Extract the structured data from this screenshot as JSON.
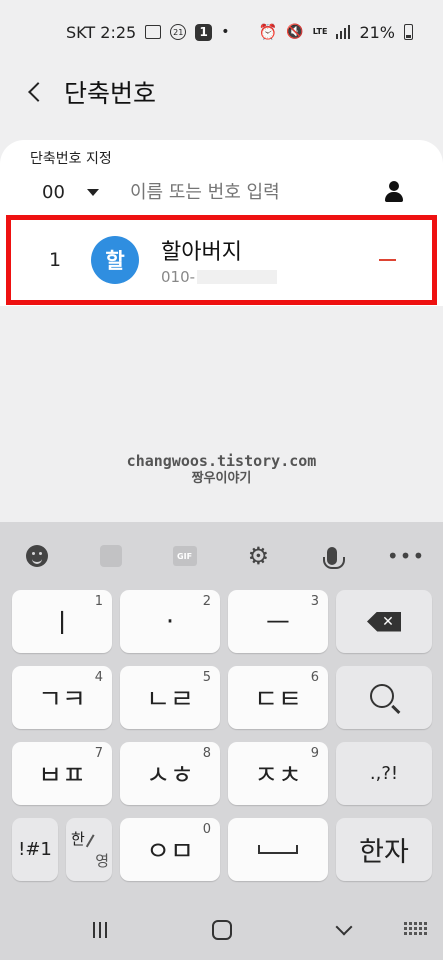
{
  "status": {
    "carrier_time": "SKT 2:25",
    "badge_circle": "21",
    "badge_fill": "1",
    "dot": "•",
    "network": "LTE",
    "battery_pct": "21%"
  },
  "appbar": {
    "title": "단축번호"
  },
  "assign": {
    "label": "단축번호 지정",
    "number": "00",
    "placeholder": "이름 또는 번호 입력"
  },
  "entry": {
    "number": "1",
    "avatar_initial": "할",
    "name": "할아버지",
    "phone_prefix": "010-",
    "avatar_color": "#2f8ee0",
    "highlight_color": "#ee1111"
  },
  "watermark": {
    "line1": "changwoos.tistory.com",
    "line2": "짱우이야기"
  },
  "keyboard": {
    "toolbar_icons": [
      "emoji-icon",
      "sticker-icon",
      "gif-icon",
      "gear-icon",
      "mic-icon",
      "more-icon"
    ],
    "gif_label": "GIF",
    "keys": {
      "k1": {
        "label": "ㅣ",
        "num": "1"
      },
      "k2": {
        "label": "·",
        "num": "2"
      },
      "k3": {
        "label": "ㅡ",
        "num": "3"
      },
      "k4": {
        "label": "ㄱㅋ",
        "num": "4"
      },
      "k5": {
        "label": "ㄴㄹ",
        "num": "5"
      },
      "k6": {
        "label": "ㄷㅌ",
        "num": "6"
      },
      "k7": {
        "label": "ㅂㅍ",
        "num": "7"
      },
      "k8": {
        "label": "ㅅㅎ",
        "num": "8"
      },
      "k9": {
        "label": "ㅈㅊ",
        "num": "9"
      },
      "k0": {
        "label": "ㅇㅁ",
        "num": "0"
      },
      "punct": ".,?!",
      "symbols": "!#1",
      "lang_a": "한",
      "lang_b": "영",
      "hanja": "한자",
      "backspace_mark": "✕"
    }
  }
}
